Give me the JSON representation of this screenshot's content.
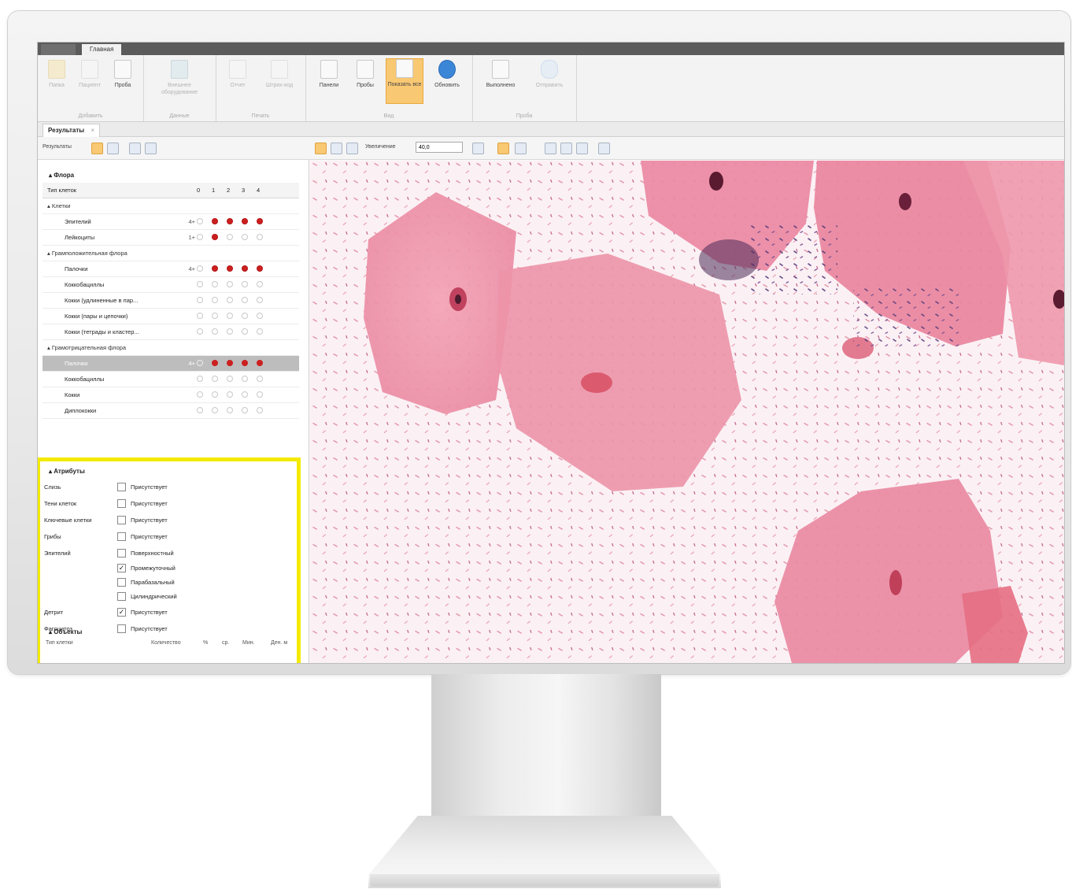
{
  "window": {
    "title_tab": "Главная"
  },
  "ribbon": {
    "groups": [
      {
        "label": "Добавить",
        "buttons": [
          {
            "label": "Папка",
            "dim": true
          },
          {
            "label": "Пациент",
            "dim": true
          },
          {
            "label": "Проба",
            "dim": false
          }
        ]
      },
      {
        "label": "Данные",
        "buttons": [
          {
            "label": "Внешнее оборудование",
            "dim": true
          }
        ]
      },
      {
        "label": "Печать",
        "buttons": [
          {
            "label": "Отчет",
            "dim": true
          },
          {
            "label": "Штрих-код",
            "dim": true
          }
        ]
      },
      {
        "label": "Вид",
        "buttons": [
          {
            "label": "Панели",
            "dim": false
          },
          {
            "label": "Пробы",
            "dim": false
          },
          {
            "label": "Показать все",
            "dim": false,
            "active": true
          },
          {
            "label": "Обновить",
            "dim": false
          }
        ]
      },
      {
        "label": "Проба",
        "buttons": [
          {
            "label": "Выполнено",
            "dim": false
          },
          {
            "label": "Отправить",
            "dim": true
          }
        ]
      }
    ]
  },
  "doc_tab": {
    "label": "Результаты",
    "close": "×"
  },
  "toolbar": {
    "results_label": "Результаты",
    "zoom_label": "Увеличение",
    "zoom_value": "40,0"
  },
  "flora": {
    "title": "Флора",
    "header": {
      "name": "Тип клеток",
      "scale": [
        "0",
        "1",
        "2",
        "3",
        "4"
      ]
    },
    "groups": [
      {
        "title": "Клетки",
        "rows": [
          {
            "name": "Эпителий",
            "value": "4+",
            "level": 4
          },
          {
            "name": "Лейкоциты",
            "value": "1+",
            "level": 1
          }
        ]
      },
      {
        "title": "Грамположительная флора",
        "rows": [
          {
            "name": "Палочки",
            "value": "4+",
            "level": 4
          },
          {
            "name": "Коккобациллы",
            "value": "",
            "level": 0
          },
          {
            "name": "Кокки (удлиненные в пар...",
            "value": "",
            "level": 0
          },
          {
            "name": "Кокки (пары и цепочки)",
            "value": "",
            "level": 0
          },
          {
            "name": "Кокки (тетрады и кластер...",
            "value": "",
            "level": 0
          }
        ]
      },
      {
        "title": "Грамотрицательная флора",
        "rows": [
          {
            "name": "Палочки",
            "value": "4+",
            "level": 4,
            "selected": true
          },
          {
            "name": "Коккобациллы",
            "value": "",
            "level": 0
          },
          {
            "name": "Кокки",
            "value": "",
            "level": 0
          },
          {
            "name": "Диплококки",
            "value": "",
            "level": 0
          }
        ]
      }
    ]
  },
  "attributes": {
    "title": "Атрибуты",
    "rows": [
      {
        "name": "Слизь",
        "options": [
          {
            "label": "Присутствует",
            "checked": false
          }
        ]
      },
      {
        "name": "Тени клеток",
        "options": [
          {
            "label": "Присутствует",
            "checked": false
          }
        ]
      },
      {
        "name": "Ключевые клетки",
        "options": [
          {
            "label": "Присутствует",
            "checked": false
          }
        ]
      },
      {
        "name": "Грибы",
        "options": [
          {
            "label": "Присутствует",
            "checked": false
          }
        ]
      },
      {
        "name": "Эпителий",
        "options": [
          {
            "label": "Поверхностный",
            "checked": false
          },
          {
            "label": "Промежуточный",
            "checked": true
          },
          {
            "label": "Парабазальный",
            "checked": false
          },
          {
            "label": "Цилиндрический",
            "checked": false
          }
        ]
      },
      {
        "name": "Детрит",
        "options": [
          {
            "label": "Присутствует",
            "checked": true
          }
        ]
      },
      {
        "name": "Фагоцитоз",
        "options": [
          {
            "label": "Присутствует",
            "checked": false
          }
        ]
      }
    ]
  },
  "objects": {
    "title": "Объекты",
    "columns": [
      "Тип клетки",
      "Количество",
      "%",
      "ср.",
      "Мин.",
      "Ден. м"
    ]
  },
  "colors": {
    "accent_active": "#f9c873",
    "dot_filled": "#cc1f1f",
    "highlight": "#f4ea00"
  }
}
